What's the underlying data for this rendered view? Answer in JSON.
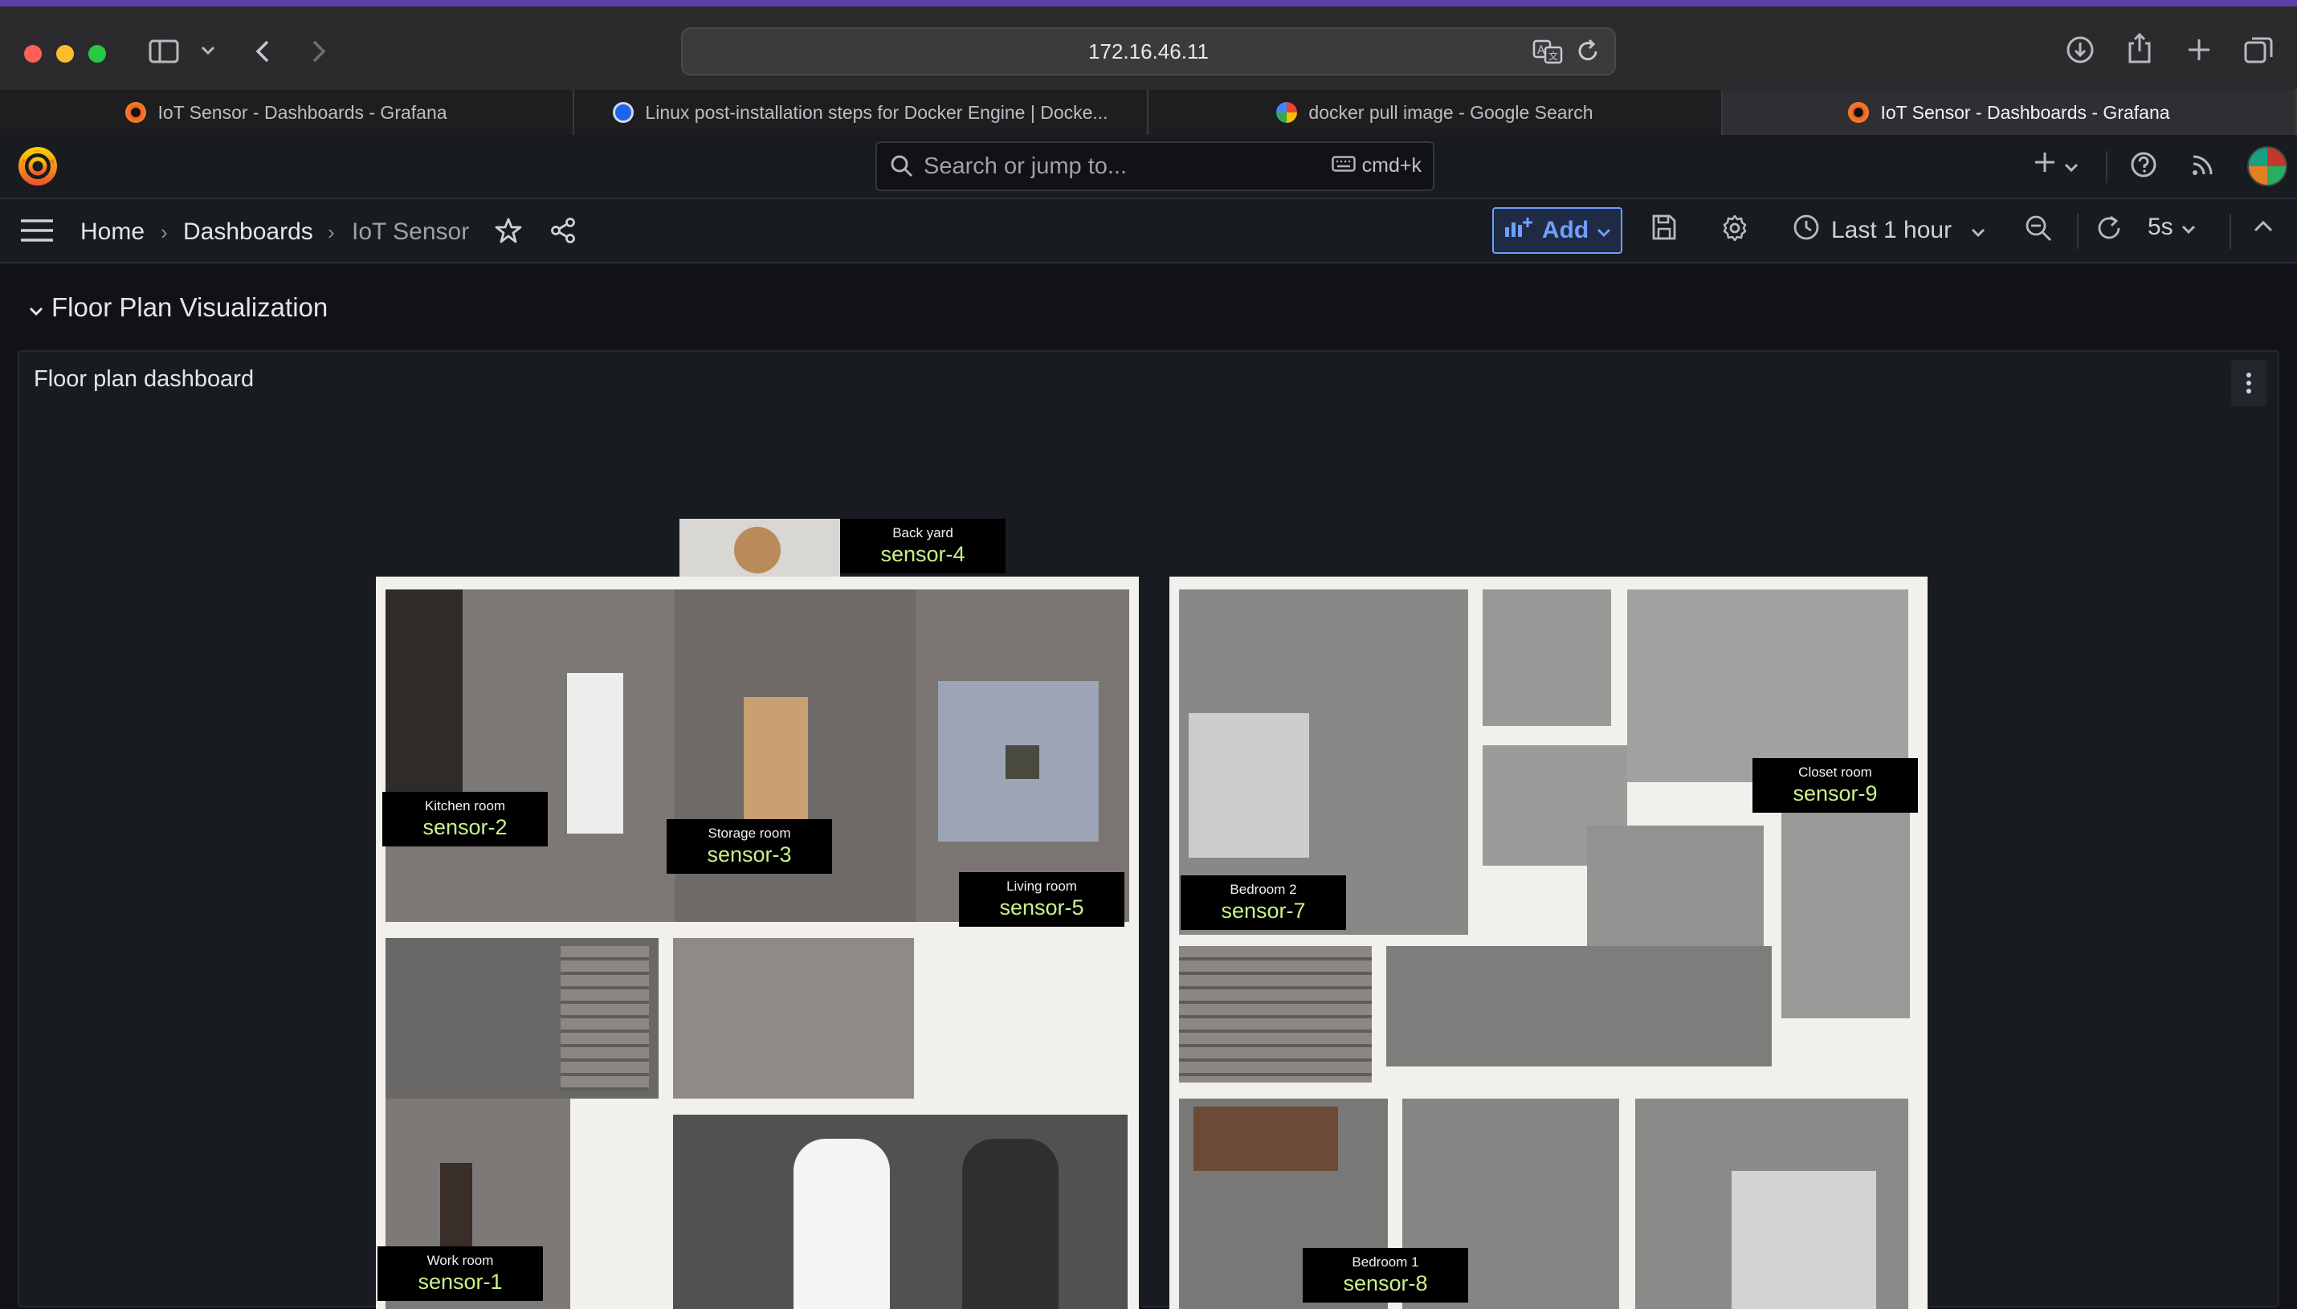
{
  "browser": {
    "url": "172.16.46.11",
    "tabs": [
      {
        "title": "IoT Sensor - Dashboards - Grafana",
        "active": false
      },
      {
        "title": "Linux post-installation steps for Docker Engine | Docke...",
        "active": false
      },
      {
        "title": "docker pull image - Google Search",
        "active": false
      },
      {
        "title": "IoT Sensor - Dashboards - Grafana",
        "active": true
      }
    ]
  },
  "topnav": {
    "search_placeholder": "Search or jump to...",
    "shortcut": "cmd+k"
  },
  "breadcrumb": {
    "home": "Home",
    "dashboards": "Dashboards",
    "current": "IoT Sensor"
  },
  "toolbar": {
    "add_label": "Add",
    "time_range": "Last 1 hour",
    "refresh_interval": "5s"
  },
  "row": {
    "title": "Floor Plan Visualization"
  },
  "panel": {
    "title": "Floor plan dashboard"
  },
  "sensors": [
    {
      "room": "Back yard",
      "id": "sensor-4"
    },
    {
      "room": "Kitchen room",
      "id": "sensor-2"
    },
    {
      "room": "Storage room",
      "id": "sensor-3"
    },
    {
      "room": "Living room",
      "id": "sensor-5"
    },
    {
      "room": "Work room",
      "id": "sensor-1"
    },
    {
      "room": "Closet room",
      "id": "sensor-9"
    },
    {
      "room": "Bedroom 2",
      "id": "sensor-7"
    },
    {
      "room": "Bedroom 1",
      "id": "sensor-8"
    }
  ],
  "colors": {
    "accent": "#6e9fff",
    "sensor_text": "#c9f28a",
    "grafana_orange": "#f05a28"
  }
}
